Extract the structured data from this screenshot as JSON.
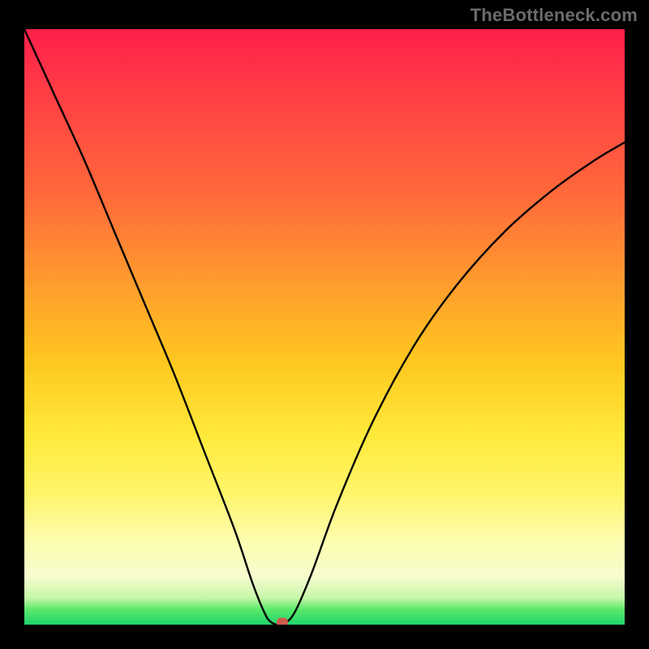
{
  "watermark": "TheBottleneck.com",
  "chart_data": {
    "type": "line",
    "title": "",
    "xlabel": "",
    "ylabel": "",
    "xlim": [
      0,
      100
    ],
    "ylim": [
      0,
      100
    ],
    "grid": false,
    "legend": false,
    "background_gradient": {
      "orientation": "vertical",
      "stops": [
        {
          "pos": 0,
          "color": "#ff1f4a"
        },
        {
          "pos": 0.28,
          "color": "#ff6a3a"
        },
        {
          "pos": 0.56,
          "color": "#ffc81f"
        },
        {
          "pos": 0.78,
          "color": "#fff56a"
        },
        {
          "pos": 0.92,
          "color": "#f6fccf"
        },
        {
          "pos": 0.975,
          "color": "#58e86a"
        },
        {
          "pos": 1.0,
          "color": "#20d36c"
        }
      ]
    },
    "series": [
      {
        "name": "bottleneck-curve",
        "x": [
          0,
          5,
          10,
          15,
          20,
          25,
          30,
          35,
          38,
          40,
          41,
          42,
          43,
          45,
          48,
          52,
          58,
          65,
          72,
          80,
          88,
          95,
          100
        ],
        "y": [
          100,
          89,
          78,
          66,
          54,
          42,
          29,
          16,
          7,
          2,
          0.5,
          0,
          0,
          2,
          9,
          20,
          34,
          47,
          57,
          66,
          73,
          78,
          81
        ]
      }
    ],
    "marker": {
      "name": "min-point",
      "x": 43,
      "y": 0,
      "color": "#cf5a4a"
    },
    "flat_segment": {
      "x_start": 40,
      "x_end": 43,
      "y": 0
    }
  }
}
